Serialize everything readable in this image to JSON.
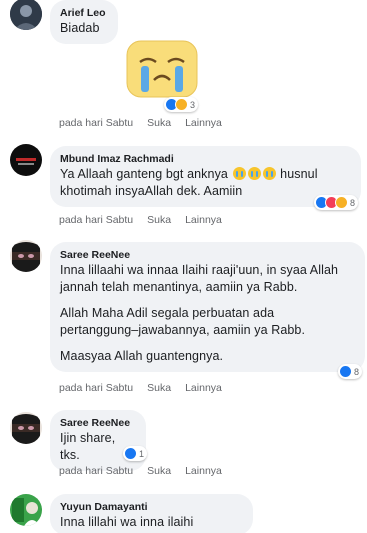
{
  "comments": [
    {
      "name": "Arief Leo",
      "text": "Biadab",
      "actions": [
        "pada hari Sabtu",
        "Suka",
        "Lainnya"
      ],
      "reaction_count": "3",
      "sticker": "crying-face-sticker"
    },
    {
      "name": "Mbund Imaz Rachmadi",
      "text_before": "Ya Allaah ganteng bgt anknya",
      "text_after": "husnul khotimah insyaAllah dek. Aamiin",
      "actions": [
        "pada hari Sabtu",
        "Suka",
        "Lainnya"
      ],
      "reaction_count": "8"
    },
    {
      "name": "Saree ReeNee",
      "paragraphs": [
        "Inna lillaahi wa innaa Ilaihi raaji'uun, in syaa Allah jannah telah menantinya, aamiin ya Rabb.",
        "Allah Maha Adil segala perbuatan ada pertanggung–jawabannya, aamiin ya Rabb.",
        "Maasyaa Allah guantengnya."
      ],
      "actions": [
        "pada hari Sabtu",
        "Suka",
        "Lainnya"
      ],
      "reaction_count": "8"
    },
    {
      "name": "Saree ReeNee",
      "text": "Ijin share, tks.",
      "actions": [
        "pada hari Sabtu",
        "Suka",
        "Lainnya"
      ],
      "reaction_count": "1"
    },
    {
      "name": "Yuyun Damayanti",
      "text": "Inna lillahi wa inna ilaihi raaji'uun"
    }
  ],
  "colors": {
    "bubble": "#f0f2f5",
    "like": "#1877f2",
    "love": "#f33e58",
    "sad": "#f7b125",
    "meta": "#65676b"
  }
}
